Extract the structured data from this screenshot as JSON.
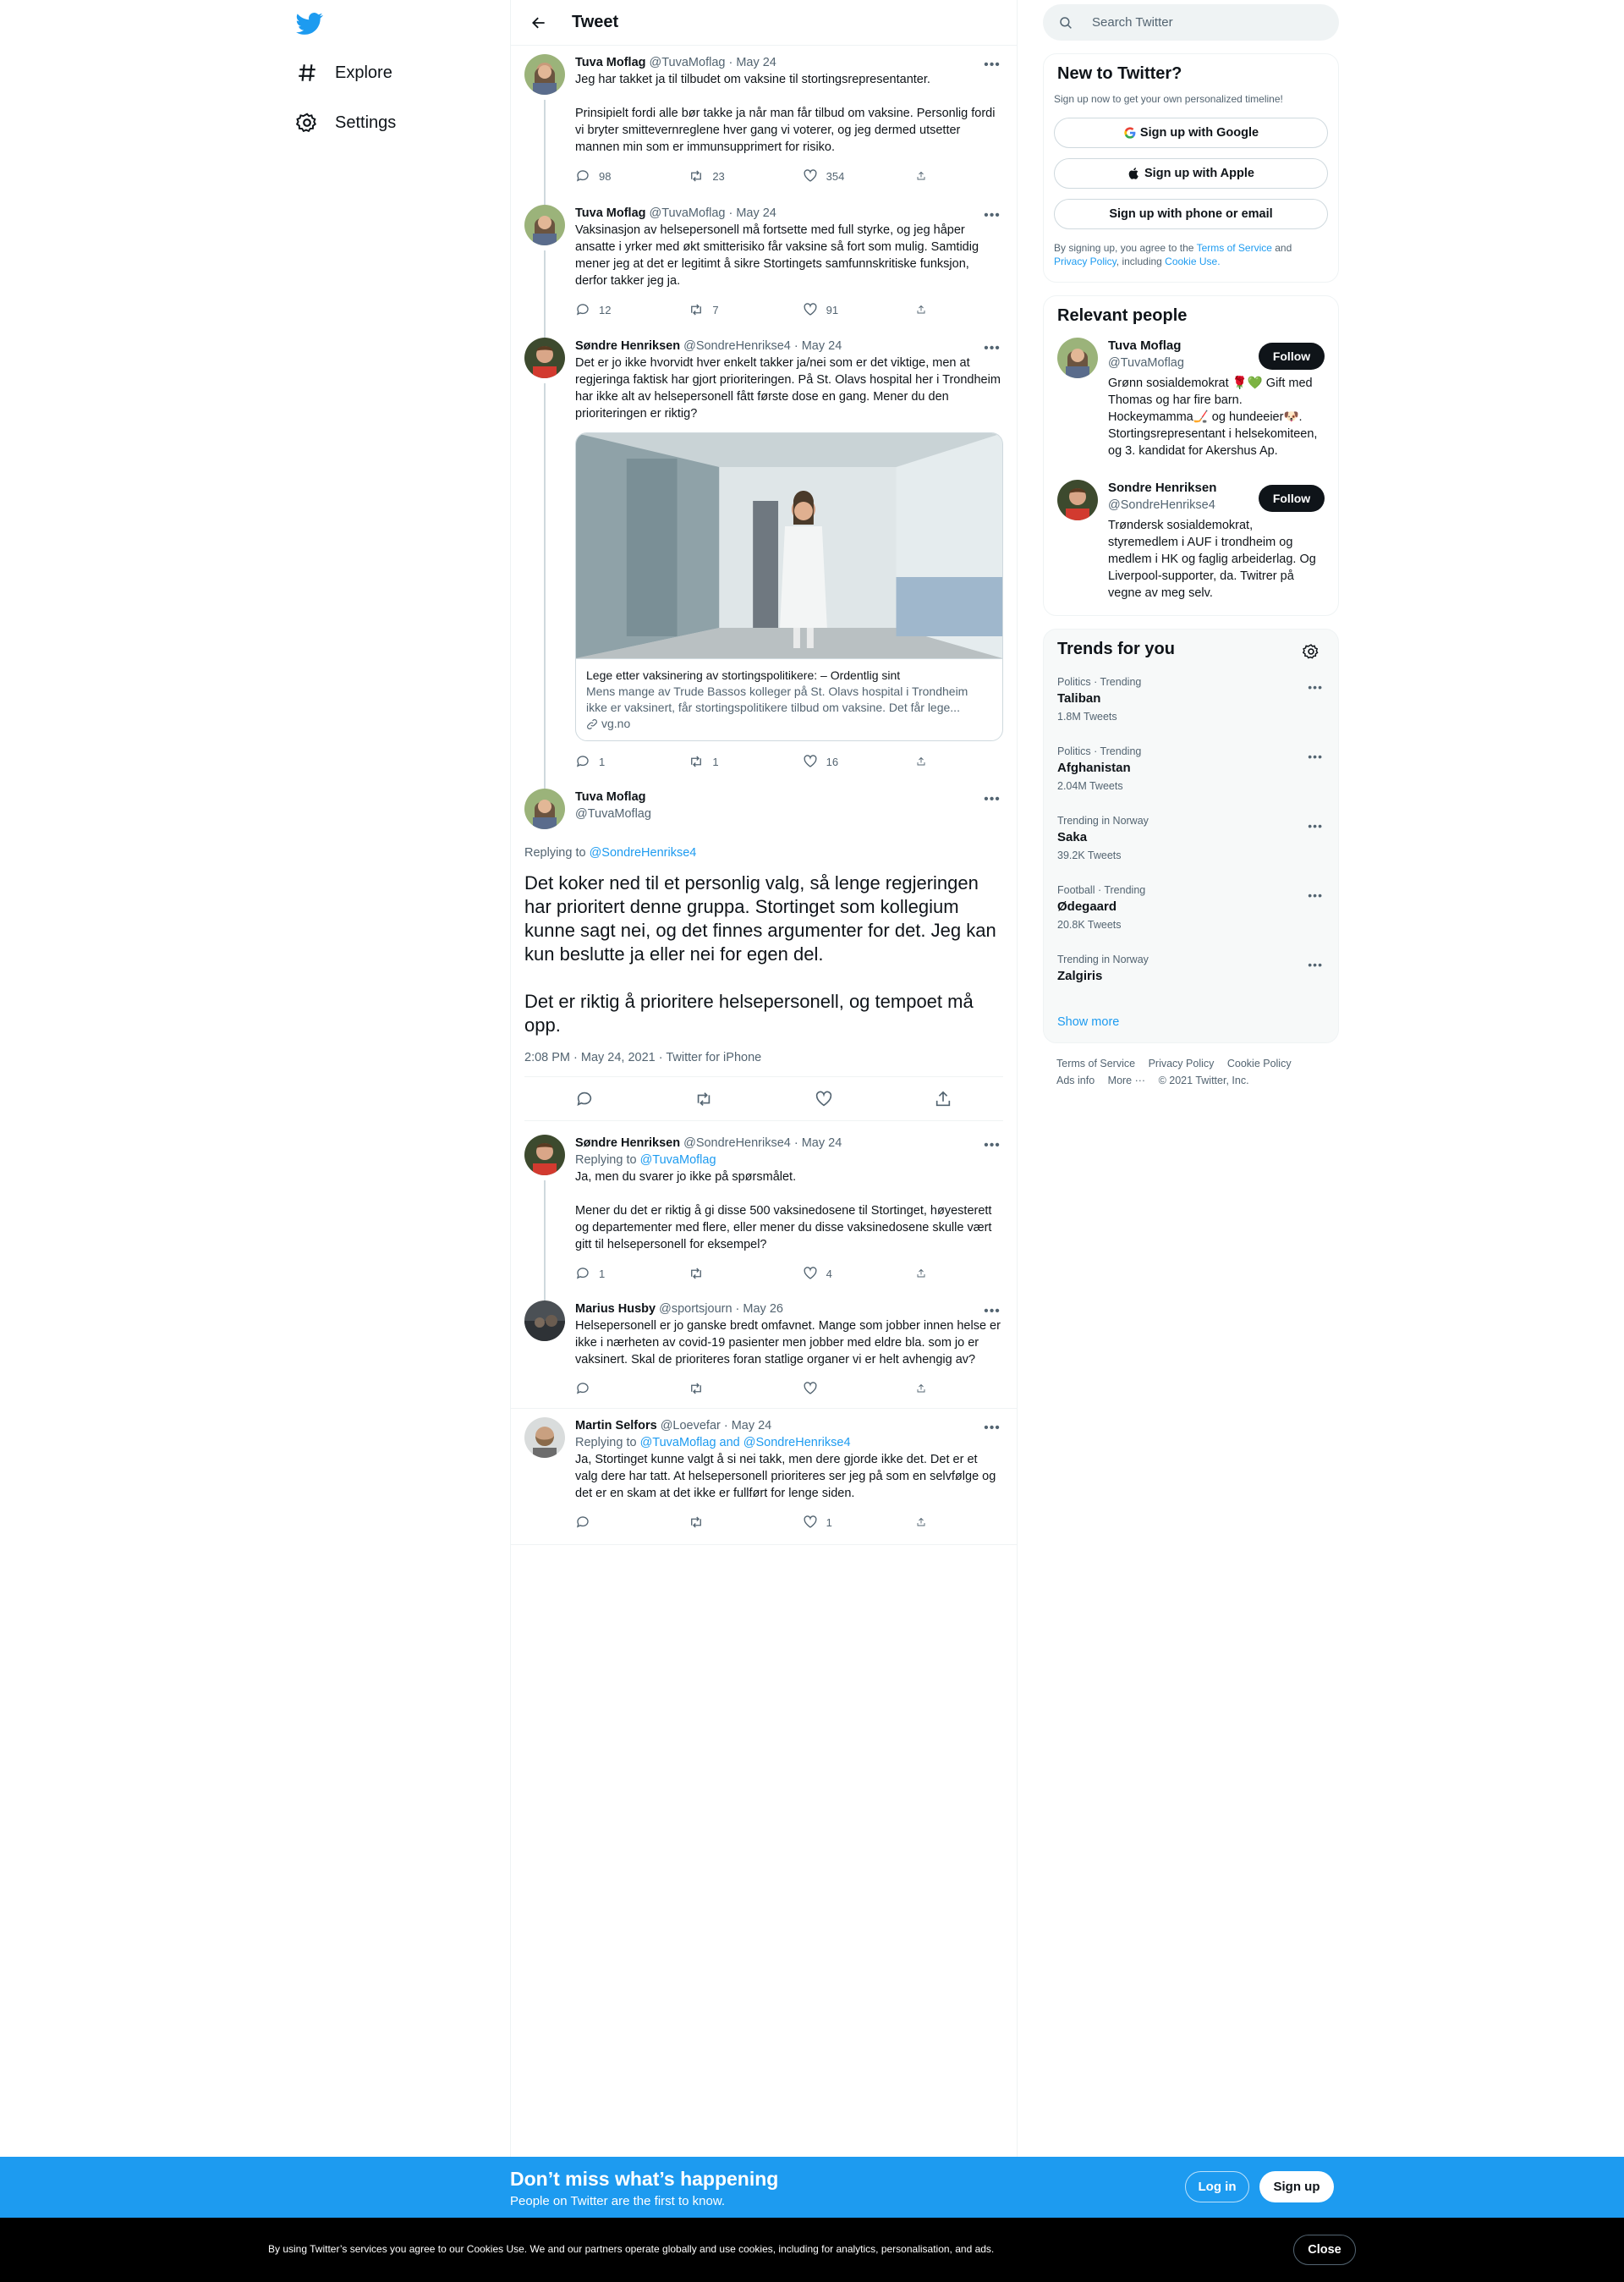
{
  "nav": {
    "explore_label": "Explore",
    "settings_label": "Settings"
  },
  "main": {
    "title": "Tweet"
  },
  "tweets": [
    {
      "name": "Tuva Moflag",
      "handle": "@TuvaMoflag",
      "date": "· May 24",
      "text": "Jeg har takket ja til tilbudet om vaksine til stortingsrepresentanter.\n\nPrinsipielt fordi alle bør takke ja når man får tilbud om vaksine. Personlig fordi vi bryter smittevernreglene hver gang vi voterer, og jeg dermed utsetter mannen min som er immunsupprimert for risiko.",
      "replies": "98",
      "retweets": "23",
      "likes": "354"
    },
    {
      "name": "Tuva Moflag",
      "handle": "@TuvaMoflag",
      "date": "· May 24",
      "text": "Vaksinasjon av helsepersonell må fortsette med full styrke, og jeg håper ansatte i yrker med økt smitterisiko får vaksine så fort som mulig. Samtidig mener jeg at det er legitimt å sikre Stortingets samfunnskritiske funksjon, derfor takker jeg ja.",
      "replies": "12",
      "retweets": "7",
      "likes": "91"
    },
    {
      "name": "Søndre Henriksen",
      "handle": "@SondreHenrikse4",
      "date": "· May 24",
      "text": "Det er jo ikke hvorvidt hver enkelt takker ja/nei som er det viktige, men at regjeringa faktisk har gjort prioriteringen. På St. Olavs hospital her i Trondheim har ikke alt av helsepersonell fått første dose en gang. Mener du den prioriteringen er riktig?",
      "card_title": "Lege etter vaksinering av stortingspolitikere: – Ordentlig sint",
      "card_desc": "Mens mange av Trude Bassos kolleger på St. Olavs hospital i Trondheim ikke er vaksinert, får stortingspolitikere tilbud om vaksine. Det får lege...",
      "card_domain": "vg.no",
      "replies": "1",
      "retweets": "1",
      "likes": "16"
    }
  ],
  "focus": {
    "name": "Tuva Moflag",
    "handle": "@TuvaMoflag",
    "replying_prefix": "Replying to",
    "replying_to": "@SondreHenrikse4",
    "text": "Det koker ned til et personlig valg, så lenge regjeringen har prioritert denne gruppa. Stortinget som kollegium kunne sagt nei, og det finnes argumenter for det. Jeg kan kun beslutte ja eller nei for egen del.\n\nDet er riktig å prioritere helsepersonell, og tempoet må opp.",
    "meta": "2:08 PM · May 24, 2021 · Twitter for iPhone"
  },
  "replies": [
    {
      "name": "Søndre Henriksen",
      "handle": "@SondreHenrikse4",
      "date": "· May 24",
      "replying_prefix": "Replying to",
      "replying_to": "@TuvaMoflag",
      "text": "Ja, men du svarer jo ikke på spørsmålet.\n\nMener du det er riktig å gi disse 500 vaksinedosene til Stortinget, høyesterett og departementer med flere, eller mener du disse vaksinedosene skulle vært gitt til helsepersonell for eksempel?",
      "replies": "1",
      "retweets": "",
      "likes": "4"
    },
    {
      "name": "Marius Husby",
      "handle": "@sportsjourn",
      "date": "· May 26",
      "text": "Helsepersonell er jo ganske bredt omfavnet. Mange som jobber innen helse er ikke i nærheten av covid-19 pasienter men jobber med eldre bla. som jo er vaksinert. Skal de prioriteres foran statlige organer vi er helt avhengig av?",
      "replies": "",
      "retweets": "",
      "likes": ""
    },
    {
      "name": "Martin Selfors",
      "handle": "@Loevefar",
      "date": "· May 24",
      "replying_prefix": "Replying to",
      "replying_to": "@TuvaMoflag and @SondreHenrikse4",
      "text": "Ja, Stortinget kunne valgt å si nei takk, men dere gjorde ikke det. Det er et valg dere har tatt. At helsepersonell prioriteres ser jeg på som en selvfølge og det er en skam at det ikke er fullført for lenge siden.",
      "replies": "",
      "retweets": "",
      "likes": "1"
    }
  ],
  "sidebar": {
    "search_placeholder": "Search Twitter",
    "new_title": "New to Twitter?",
    "new_sub": "Sign up now to get your own personalized timeline!",
    "google_label": "Sign up with Google",
    "apple_label": "Sign up with Apple",
    "phone_label": "Sign up with phone or email",
    "terms_1": "By signing up, you agree to the ",
    "terms_link": "Terms of Service",
    "terms_2": " and ",
    "privacy_link": "Privacy Policy",
    "terms_3": ", including ",
    "cookie_link": "Cookie Use.",
    "relevant_title": "Relevant people",
    "people": [
      {
        "name": "Tuva Moflag",
        "handle": "@TuvaMoflag",
        "bio": "Grønn sosialdemokrat 🌹💚 Gift med Thomas og har fire barn. Hockeymamma🏒 og hundeeier🐶. Stortingsrepresentant i helsekomiteen, og 3. kandidat for Akershus Ap.",
        "follow_label": "Follow"
      },
      {
        "name": "Sondre Henriksen",
        "handle": "@SondreHenrikse4",
        "bio": "Trøndersk sosialdemokrat, styremedlem i AUF i trondheim og medlem i HK og faglig arbeiderlag. Og Liverpool-supporter, da. Twitrer på vegne av meg selv.",
        "follow_label": "Follow"
      }
    ],
    "trends_title": "Trends for you",
    "trends": [
      {
        "context": "Politics · Trending",
        "name": "Taliban",
        "count": "1.8M Tweets"
      },
      {
        "context": "Politics · Trending",
        "name": "Afghanistan",
        "count": "2.04M Tweets"
      },
      {
        "context": "Trending in Norway",
        "name": "Saka",
        "count": "39.2K Tweets"
      },
      {
        "context": "Football · Trending",
        "name": "Ødegaard",
        "count": "20.8K Tweets"
      },
      {
        "context": "Trending in Norway",
        "name": "Zalgiris",
        "count": ""
      }
    ],
    "show_more": "Show more",
    "footer": {
      "terms": "Terms of Service",
      "privacy": "Privacy Policy",
      "cookie": "Cookie Policy",
      "ads": "Ads info",
      "more": "More ···",
      "copyright": "© 2021 Twitter, Inc."
    }
  },
  "cta": {
    "title": "Don’t miss what’s happening",
    "subtitle": "People on Twitter are the first to know.",
    "login_label": "Log in",
    "signup_label": "Sign up"
  },
  "cookie": {
    "text": "By using Twitter’s services you agree to our Cookies Use. We and our partners operate globally and use cookies, including for analytics, personalisation, and ads.",
    "close_label": "Close"
  },
  "colors": {
    "accent": "#1d9bf0",
    "text": "#0f1419",
    "muted": "#536471"
  }
}
